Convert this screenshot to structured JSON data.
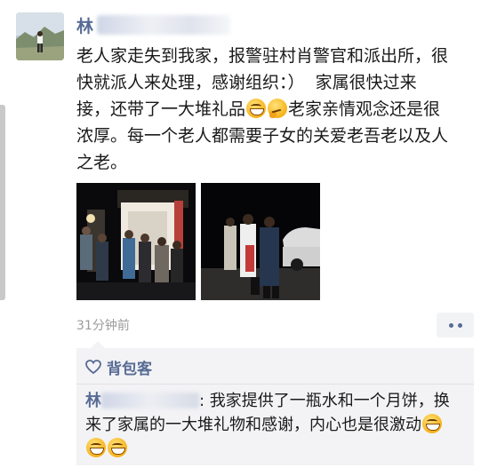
{
  "post": {
    "author_visible": "林",
    "text_part1": "老人家走失到我家，报警驻村肖警官和派出所，很快就派人来处理，感谢组织：）  家属很快过来接，还带了一大堆礼品",
    "text_part2": "老家亲情观念还是很浓厚。每一个老人都需要子女的关爱老吾老以及人之老。",
    "emoji_1": "grin-emoji",
    "emoji_2": "think-emoji",
    "timestamp": "31分钟前"
  },
  "likes": {
    "icon": "heart-icon",
    "names": "背包客"
  },
  "comment": {
    "author_visible": "林",
    "text": ": 我家提供了一瓶水和一个月饼，换来了家属的一大堆礼物和感谢，内心也是很激动",
    "trailing_emoji_count": 3
  },
  "colors": {
    "link": "#576b95",
    "timestamp": "#9b9b9b",
    "comment_bg": "#f3f3f5"
  }
}
